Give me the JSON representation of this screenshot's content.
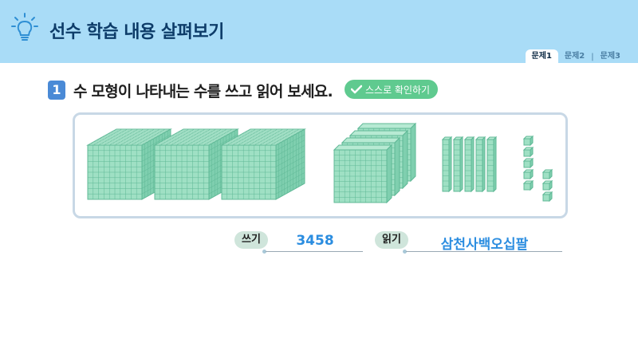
{
  "header": {
    "title": "선수 학습 내용 살펴보기",
    "icon": "lightbulb-icon"
  },
  "tabs": [
    {
      "label": "문제1",
      "active": true
    },
    {
      "label": "문제2",
      "active": false
    },
    {
      "label": "문제3",
      "active": false
    }
  ],
  "tab_separator": "|",
  "question": {
    "number": "1",
    "text": "수 모형이 나타내는 수를 쓰고 읽어 보세요.",
    "check_button": "스스로 확인하기"
  },
  "blocks": {
    "thousands": 3,
    "hundreds": 4,
    "tens": 5,
    "ones": 8
  },
  "answers": {
    "write_label": "쓰기",
    "write_value": "3458",
    "read_label": "읽기",
    "read_value": "삼천사백오십팔"
  },
  "colors": {
    "header_bg": "#a9dcf7",
    "block_fill": "#9fe0c4",
    "block_stroke": "#5fb896",
    "answer_color": "#2b8de0",
    "check_button": "#5fca8f"
  }
}
